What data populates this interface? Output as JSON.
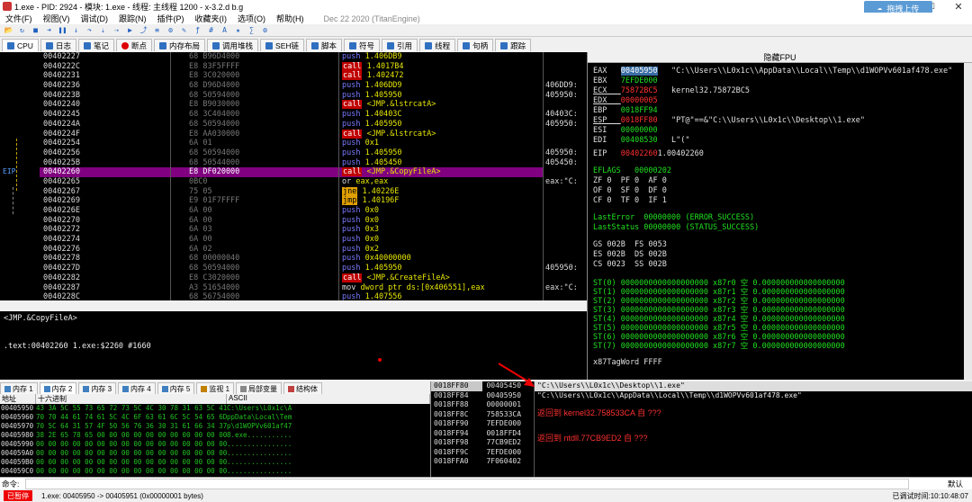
{
  "title_bar": {
    "title": "1.exe - PID: 2924 - 模块: 1.exe - 线程: 主线程 1200 - x-3.2.d b.g",
    "sync_button": "拖拽上传"
  },
  "menu": {
    "items": [
      "文件(F)",
      "视图(V)",
      "调试(D)",
      "跟踪(N)",
      "插件(P)",
      "收藏夹(I)",
      "选项(O)",
      "帮助(H)"
    ],
    "date": "Dec 22 2020 (TitanEngine)"
  },
  "tabs": [
    "CPU",
    "日志",
    "笔记",
    "断点",
    "内存布局",
    "调用堆栈",
    "SEH链",
    "脚本",
    "符号",
    "引用",
    "线程",
    "句柄",
    "跟踪"
  ],
  "cpu": {
    "eip_label": "EIP",
    "rows": [
      {
        "addr": "00402227",
        "bytes": "68 B96D4000",
        "mn": "push",
        "op": "1.406DB9",
        "cm": ""
      },
      {
        "addr": "0040222C",
        "bytes": "E8 83F5FFFF",
        "mn": "call",
        "op": "1.4017B4",
        "cm": ""
      },
      {
        "addr": "00402231",
        "bytes": "E8 3C020000",
        "mn": "call",
        "op": "1.402472",
        "cm": ""
      },
      {
        "addr": "00402236",
        "bytes": "68 D96D4000",
        "mn": "push",
        "op": "1.406DD9",
        "cm": "406DD9:"
      },
      {
        "addr": "0040223B",
        "bytes": "68 50594000",
        "mn": "push",
        "op": "1.405950",
        "cm": "405950:"
      },
      {
        "addr": "00402240",
        "bytes": "E8 B9030000",
        "mn": "call",
        "op": "<JMP.&lstrcatA>",
        "cm": ""
      },
      {
        "addr": "00402245",
        "bytes": "68 3C404000",
        "mn": "push",
        "op": "1.40403C",
        "cm": "40403C:"
      },
      {
        "addr": "0040224A",
        "bytes": "68 50594000",
        "mn": "push",
        "op": "1.405950",
        "cm": "405950:"
      },
      {
        "addr": "0040224F",
        "bytes": "E8 AA030000",
        "mn": "call",
        "op": "<JMP.&lstrcatA>",
        "cm": ""
      },
      {
        "addr": "00402254",
        "bytes": "6A 01",
        "mn": "push",
        "op": "0x1",
        "cm": ""
      },
      {
        "addr": "00402256",
        "bytes": "68 50594000",
        "mn": "push",
        "op": "1.405950",
        "cm": "405950:"
      },
      {
        "addr": "0040225B",
        "bytes": "68 50544000",
        "mn": "push",
        "op": "1.405450",
        "cm": "405450:"
      },
      {
        "addr": "00402260",
        "bytes": "E8 DF020000",
        "mn": "call",
        "op": "<JMP.&CopyFileA>",
        "cm": ""
      },
      {
        "addr": "00402265",
        "bytes": "0BC0",
        "mn": "or",
        "op": "eax,eax",
        "cm": "eax:\"C:"
      },
      {
        "addr": "00402267",
        "bytes": "75 05",
        "mn": "jne",
        "op": "1.40226E",
        "cm": ""
      },
      {
        "addr": "00402269",
        "bytes": "E9 01F7FFFF",
        "mn": "jmp",
        "op": "1.40196F",
        "cm": ""
      },
      {
        "addr": "0040226E",
        "bytes": "6A 00",
        "mn": "push",
        "op": "0x0",
        "cm": ""
      },
      {
        "addr": "00402270",
        "bytes": "6A 00",
        "mn": "push",
        "op": "0x0",
        "cm": ""
      },
      {
        "addr": "00402272",
        "bytes": "6A 03",
        "mn": "push",
        "op": "0x3",
        "cm": ""
      },
      {
        "addr": "00402274",
        "bytes": "6A 00",
        "mn": "push",
        "op": "0x0",
        "cm": ""
      },
      {
        "addr": "00402276",
        "bytes": "6A 02",
        "mn": "push",
        "op": "0x2",
        "cm": ""
      },
      {
        "addr": "00402278",
        "bytes": "68 00000040",
        "mn": "push",
        "op": "0x40000000",
        "cm": ""
      },
      {
        "addr": "0040227D",
        "bytes": "68 50594000",
        "mn": "push",
        "op": "1.405950",
        "cm": "405950:"
      },
      {
        "addr": "00402282",
        "bytes": "E8 C3020000",
        "mn": "call",
        "op": "<JMP.&CreateFileA>",
        "cm": ""
      },
      {
        "addr": "00402287",
        "bytes": "A3 51654000",
        "mn": "mov",
        "op": "dword ptr ds:[0x406551],eax",
        "cm": "eax:\"C:"
      },
      {
        "addr": "0040228C",
        "bytes": "68 56754000",
        "mn": "push",
        "op": "1.407556",
        "cm": ""
      }
    ]
  },
  "info": {
    "line1": "<JMP.&CopyFileA>",
    "line2": ".text:00402260 1.exe:$2260 #1660"
  },
  "registers": {
    "header": "隐藏FPU",
    "regs": [
      {
        "n": "EAX",
        "v": "00405950",
        "c": "\"C:\\\\Users\\\\L0x1c\\\\AppData\\\\Local\\\\Temp\\\\d1WOPVv601af478.exe\""
      },
      {
        "n": "EBX",
        "v": "7EFDE000",
        "c": ""
      },
      {
        "n": "ECX",
        "v": "75872BC5",
        "c": "kernel32.75872BC5"
      },
      {
        "n": "EDX",
        "v": "00000005",
        "c": ""
      },
      {
        "n": "EBP",
        "v": "0018FF94",
        "c": ""
      },
      {
        "n": "ESP",
        "v": "0018FF80",
        "c": "\"PT@\"==&\"C:\\\\Users\\\\L0x1c\\\\Desktop\\\\1.exe\""
      },
      {
        "n": "ESI",
        "v": "00000000",
        "c": ""
      },
      {
        "n": "EDI",
        "v": "00408530",
        "c": "L\"(\""
      }
    ],
    "eip": {
      "n": "EIP",
      "v": "00402260",
      "c": "1.00402260"
    },
    "eflags": "EFLAGS   00000202",
    "flags": [
      "ZF 0  PF 0  AF 0",
      "OF 0  SF 0  DF 0",
      "CF 0  TF 0  IF 1"
    ],
    "lasterror": "LastError  00000000 (ERROR_SUCCESS)",
    "laststatus": "LastStatus 00000000 (STATUS_SUCCESS)",
    "segs": [
      "GS 002B  FS 0053",
      "ES 002B  DS 002B",
      "CS 0023  SS 002B"
    ],
    "st": [
      "ST(0) 0000000000000000000 x87r0 空 0.000000000000000000",
      "ST(1) 0000000000000000000 x87r1 空 0.000000000000000000",
      "ST(2) 0000000000000000000 x87r2 空 0.000000000000000000",
      "ST(3) 0000000000000000000 x87r3 空 0.000000000000000000",
      "ST(4) 0000000000000000000 x87r4 空 0.000000000000000000",
      "ST(5) 0000000000000000000 x87r5 空 0.000000000000000000",
      "ST(6) 0000000000000000000 x87r6 空 0.000000000000000000",
      "ST(7) 0000000000000000000 x87r7 空 0.000000000000000000"
    ],
    "tagword": "x87TagWord FFFF"
  },
  "mem_tabs": [
    "内存 1",
    "内存 2",
    "内存 3",
    "内存 4",
    "内存 5",
    "监视 1",
    "局部变量",
    "结构体"
  ],
  "dump": {
    "headers": [
      "地址",
      "十六进制",
      "ASCII"
    ],
    "rows": [
      {
        "a": "00405950",
        "h": "43 3A 5C 55 73 65 72 73 5C 4C 30 78 31 63 5C 41",
        "s": "C:\\Users\\L0x1c\\A"
      },
      {
        "a": "00405960",
        "h": "70 70 44 61 74 61 5C 4C 6F 63 61 6C 5C 54 65 6D",
        "s": "ppData\\Local\\Tem"
      },
      {
        "a": "00405970",
        "h": "70 5C 64 31 57 4F 50 56 76 36 30 31 61 66 34 37",
        "s": "p\\d1WOPVv601af47"
      },
      {
        "a": "00405980",
        "h": "38 2E 65 78 65 00 00 00 00 00 00 00 00 00 00 00",
        "s": "8.exe..........."
      },
      {
        "a": "00405990",
        "h": "00 00 00 00 00 00 00 00 00 00 00 00 00 00 00 00",
        "s": "................"
      },
      {
        "a": "004059A0",
        "h": "00 00 00 00 00 00 00 00 00 00 00 00 00 00 00 00",
        "s": "................"
      },
      {
        "a": "004059B0",
        "h": "00 00 00 00 00 00 00 00 00 00 00 00 00 00 00 00",
        "s": "................"
      },
      {
        "a": "004059C0",
        "h": "00 00 00 00 00 00 00 00 00 00 00 00 00 00 00 00",
        "s": "................"
      }
    ]
  },
  "stack": {
    "rows": [
      {
        "a": "0018FF80",
        "v": "00405450"
      },
      {
        "a": "0018FF84",
        "v": "00405950"
      },
      {
        "a": "0018FF88",
        "v": "00000001"
      },
      {
        "a": "0018FF8C",
        "v": "758533CA"
      },
      {
        "a": "0018FF90",
        "v": "7EFDE000"
      },
      {
        "a": "0018FF94",
        "v": "0018FFD4"
      },
      {
        "a": "0018FF98",
        "v": "77CB9ED2"
      },
      {
        "a": "0018FF9C",
        "v": "7EFDE000"
      },
      {
        "a": "0018FFA0",
        "v": "7F060402"
      }
    ],
    "comments": [
      "\"C:\\\\Users\\\\L0x1c\\\\Desktop\\\\1.exe\"",
      "\"C:\\\\Users\\\\L0x1c\\\\AppData\\\\Local\\\\Temp\\\\d1WOPVv601af478.exe\"",
      "返回到 kernel32.758533CA 自 ???",
      "返回到 ntdll.77CB9ED2 自 ???"
    ]
  },
  "command": {
    "label": "命令:",
    "default": "默认"
  },
  "status": {
    "paused": "已暂停",
    "message": "1.exe: 00405950 -> 00405951 (0x00000001 bytes)",
    "time_label": "已调试时间:",
    "time": "10:10:48:07"
  }
}
